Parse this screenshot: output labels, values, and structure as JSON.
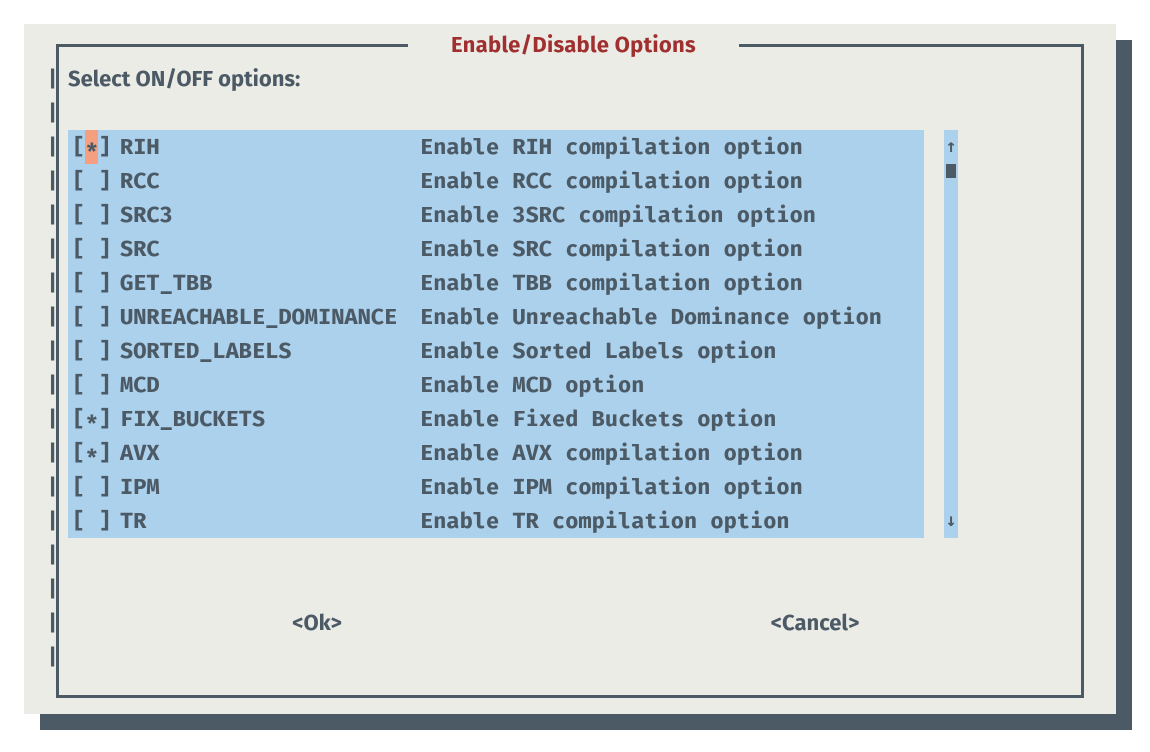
{
  "title": "Enable/Disable Options",
  "prompt": "Select ON/OFF options:",
  "buttons": {
    "ok": "<Ok>",
    "cancel": "<Cancel>"
  },
  "scroll": {
    "up_glyph": "↑",
    "down_glyph": "↓"
  },
  "cursor_row": 0,
  "options": [
    {
      "name": "RIH",
      "desc": "Enable RIH compilation option",
      "checked": true
    },
    {
      "name": "RCC",
      "desc": "Enable RCC compilation option",
      "checked": false
    },
    {
      "name": "SRC3",
      "desc": "Enable 3SRC compilation option",
      "checked": false
    },
    {
      "name": "SRC",
      "desc": "Enable SRC compilation option",
      "checked": false
    },
    {
      "name": "GET_TBB",
      "desc": "Enable TBB compilation option",
      "checked": false
    },
    {
      "name": "UNREACHABLE_DOMINANCE",
      "desc": "Enable Unreachable Dominance option",
      "checked": false
    },
    {
      "name": "SORTED_LABELS",
      "desc": "Enable Sorted Labels option",
      "checked": false
    },
    {
      "name": "MCD",
      "desc": "Enable MCD option",
      "checked": false
    },
    {
      "name": "FIX_BUCKETS",
      "desc": "Enable Fixed Buckets option",
      "checked": true
    },
    {
      "name": "AVX",
      "desc": "Enable AVX compilation option",
      "checked": true
    },
    {
      "name": "IPM",
      "desc": "Enable IPM compilation option",
      "checked": false
    },
    {
      "name": "TR",
      "desc": "Enable TR compilation option",
      "checked": false
    }
  ]
}
